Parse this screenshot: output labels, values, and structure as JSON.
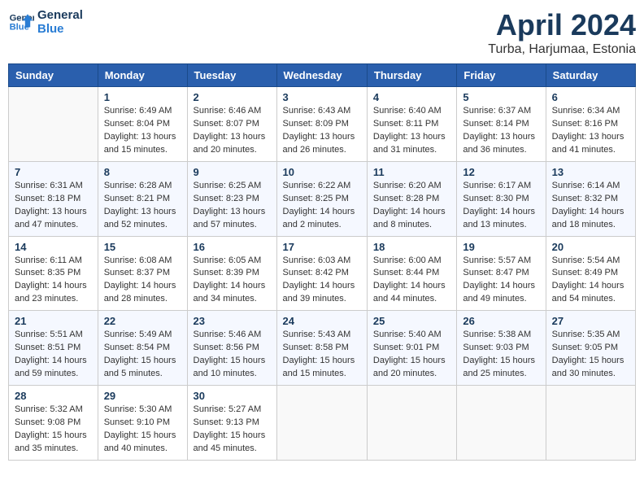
{
  "logo": {
    "line1": "General",
    "line2": "Blue"
  },
  "title": "April 2024",
  "subtitle": "Turba, Harjumaa, Estonia",
  "weekdays": [
    "Sunday",
    "Monday",
    "Tuesday",
    "Wednesday",
    "Thursday",
    "Friday",
    "Saturday"
  ],
  "weeks": [
    [
      {
        "day": "",
        "info": ""
      },
      {
        "day": "1",
        "info": "Sunrise: 6:49 AM\nSunset: 8:04 PM\nDaylight: 13 hours\nand 15 minutes."
      },
      {
        "day": "2",
        "info": "Sunrise: 6:46 AM\nSunset: 8:07 PM\nDaylight: 13 hours\nand 20 minutes."
      },
      {
        "day": "3",
        "info": "Sunrise: 6:43 AM\nSunset: 8:09 PM\nDaylight: 13 hours\nand 26 minutes."
      },
      {
        "day": "4",
        "info": "Sunrise: 6:40 AM\nSunset: 8:11 PM\nDaylight: 13 hours\nand 31 minutes."
      },
      {
        "day": "5",
        "info": "Sunrise: 6:37 AM\nSunset: 8:14 PM\nDaylight: 13 hours\nand 36 minutes."
      },
      {
        "day": "6",
        "info": "Sunrise: 6:34 AM\nSunset: 8:16 PM\nDaylight: 13 hours\nand 41 minutes."
      }
    ],
    [
      {
        "day": "7",
        "info": "Sunrise: 6:31 AM\nSunset: 8:18 PM\nDaylight: 13 hours\nand 47 minutes."
      },
      {
        "day": "8",
        "info": "Sunrise: 6:28 AM\nSunset: 8:21 PM\nDaylight: 13 hours\nand 52 minutes."
      },
      {
        "day": "9",
        "info": "Sunrise: 6:25 AM\nSunset: 8:23 PM\nDaylight: 13 hours\nand 57 minutes."
      },
      {
        "day": "10",
        "info": "Sunrise: 6:22 AM\nSunset: 8:25 PM\nDaylight: 14 hours\nand 2 minutes."
      },
      {
        "day": "11",
        "info": "Sunrise: 6:20 AM\nSunset: 8:28 PM\nDaylight: 14 hours\nand 8 minutes."
      },
      {
        "day": "12",
        "info": "Sunrise: 6:17 AM\nSunset: 8:30 PM\nDaylight: 14 hours\nand 13 minutes."
      },
      {
        "day": "13",
        "info": "Sunrise: 6:14 AM\nSunset: 8:32 PM\nDaylight: 14 hours\nand 18 minutes."
      }
    ],
    [
      {
        "day": "14",
        "info": "Sunrise: 6:11 AM\nSunset: 8:35 PM\nDaylight: 14 hours\nand 23 minutes."
      },
      {
        "day": "15",
        "info": "Sunrise: 6:08 AM\nSunset: 8:37 PM\nDaylight: 14 hours\nand 28 minutes."
      },
      {
        "day": "16",
        "info": "Sunrise: 6:05 AM\nSunset: 8:39 PM\nDaylight: 14 hours\nand 34 minutes."
      },
      {
        "day": "17",
        "info": "Sunrise: 6:03 AM\nSunset: 8:42 PM\nDaylight: 14 hours\nand 39 minutes."
      },
      {
        "day": "18",
        "info": "Sunrise: 6:00 AM\nSunset: 8:44 PM\nDaylight: 14 hours\nand 44 minutes."
      },
      {
        "day": "19",
        "info": "Sunrise: 5:57 AM\nSunset: 8:47 PM\nDaylight: 14 hours\nand 49 minutes."
      },
      {
        "day": "20",
        "info": "Sunrise: 5:54 AM\nSunset: 8:49 PM\nDaylight: 14 hours\nand 54 minutes."
      }
    ],
    [
      {
        "day": "21",
        "info": "Sunrise: 5:51 AM\nSunset: 8:51 PM\nDaylight: 14 hours\nand 59 minutes."
      },
      {
        "day": "22",
        "info": "Sunrise: 5:49 AM\nSunset: 8:54 PM\nDaylight: 15 hours\nand 5 minutes."
      },
      {
        "day": "23",
        "info": "Sunrise: 5:46 AM\nSunset: 8:56 PM\nDaylight: 15 hours\nand 10 minutes."
      },
      {
        "day": "24",
        "info": "Sunrise: 5:43 AM\nSunset: 8:58 PM\nDaylight: 15 hours\nand 15 minutes."
      },
      {
        "day": "25",
        "info": "Sunrise: 5:40 AM\nSunset: 9:01 PM\nDaylight: 15 hours\nand 20 minutes."
      },
      {
        "day": "26",
        "info": "Sunrise: 5:38 AM\nSunset: 9:03 PM\nDaylight: 15 hours\nand 25 minutes."
      },
      {
        "day": "27",
        "info": "Sunrise: 5:35 AM\nSunset: 9:05 PM\nDaylight: 15 hours\nand 30 minutes."
      }
    ],
    [
      {
        "day": "28",
        "info": "Sunrise: 5:32 AM\nSunset: 9:08 PM\nDaylight: 15 hours\nand 35 minutes."
      },
      {
        "day": "29",
        "info": "Sunrise: 5:30 AM\nSunset: 9:10 PM\nDaylight: 15 hours\nand 40 minutes."
      },
      {
        "day": "30",
        "info": "Sunrise: 5:27 AM\nSunset: 9:13 PM\nDaylight: 15 hours\nand 45 minutes."
      },
      {
        "day": "",
        "info": ""
      },
      {
        "day": "",
        "info": ""
      },
      {
        "day": "",
        "info": ""
      },
      {
        "day": "",
        "info": ""
      }
    ]
  ]
}
